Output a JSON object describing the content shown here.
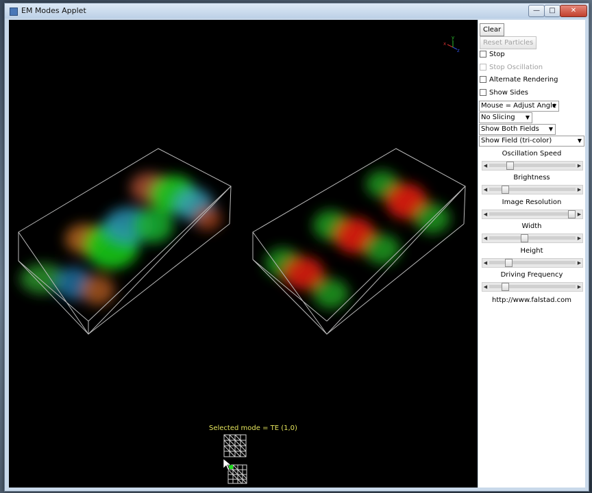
{
  "window": {
    "title": "EM Modes Applet",
    "controls": {
      "minimize": "—",
      "maximize": "□",
      "close": "✕"
    }
  },
  "canvas": {
    "axis_labels": {
      "x": "x",
      "y": "y",
      "z": "z"
    },
    "selected_mode_label": "Selected mode = TE (1,0)",
    "mode_grid": {
      "rows": 4,
      "cols": 4,
      "selected": [
        0,
        0
      ]
    },
    "cursor_icon": "mouse-pointer-icon"
  },
  "panel": {
    "buttons": {
      "clear": "Clear",
      "reset_particles": "Reset Particles"
    },
    "checkboxes": {
      "stop": "Stop",
      "stop_oscillation": "Stop Oscillation",
      "alternate_rendering": "Alternate Rendering",
      "show_sides": "Show Sides"
    },
    "selects": {
      "mouse_mode": "Mouse = Adjust Angle",
      "slicing": "No Slicing",
      "fields": "Show Both Fields",
      "field_display": "Show Field (tri-color)"
    },
    "sliders": [
      {
        "label": "Oscillation Speed",
        "value": 0.22
      },
      {
        "label": "Brightness",
        "value": 0.16
      },
      {
        "label": "Image Resolution",
        "value": 1.0
      },
      {
        "label": "Width",
        "value": 0.4
      },
      {
        "label": "Height",
        "value": 0.2
      },
      {
        "label": "Driving Frequency",
        "value": 0.16
      }
    ],
    "url": "http://www.falstad.com"
  }
}
